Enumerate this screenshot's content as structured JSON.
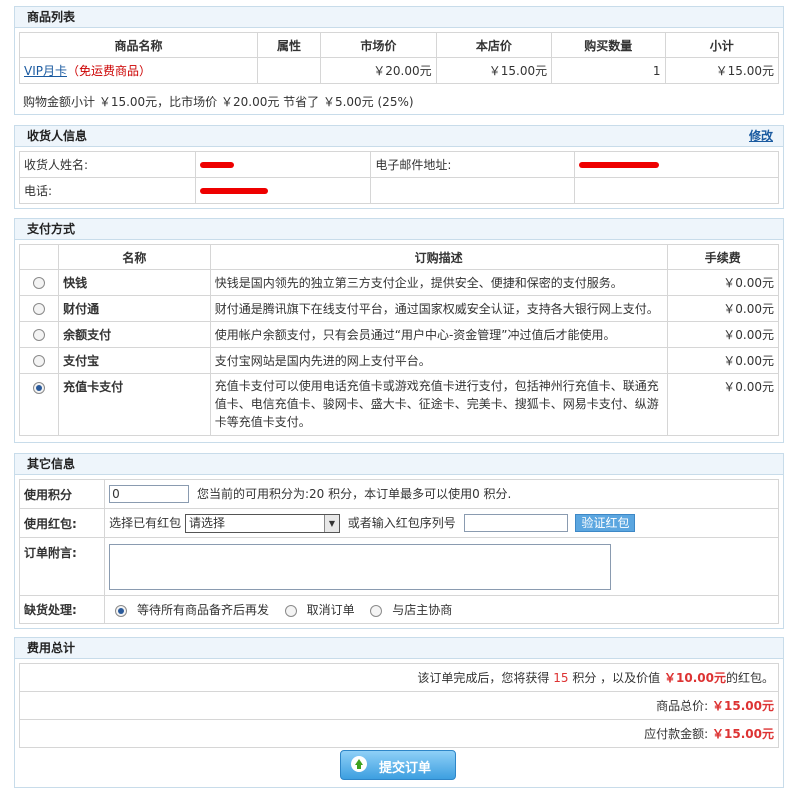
{
  "goods": {
    "title": "商品列表",
    "headers": [
      "商品名称",
      "属性",
      "市场价",
      "本店价",
      "购买数量",
      "小计"
    ],
    "item": {
      "name": "VIP月卡",
      "tag": "（免运费商品）",
      "attr": "",
      "market": "￥20.00元",
      "shop": "￥15.00元",
      "qty": "1",
      "subtotal": "￥15.00元"
    },
    "summary": "购物金额小计 ￥15.00元，比市场价 ￥20.00元 节省了 ￥5.00元 (25%)"
  },
  "consignee": {
    "title": "收货人信息",
    "edit": "修改",
    "name_label": "收货人姓名:",
    "email_label": "电子邮件地址:",
    "phone_label": "电话:"
  },
  "payment": {
    "title": "支付方式",
    "headers": [
      "名称",
      "订购描述",
      "手续费"
    ],
    "methods": [
      {
        "name": "快钱",
        "desc": "快钱是国内领先的独立第三方支付企业，提供安全、便捷和保密的支付服务。",
        "fee": "￥0.00元",
        "selected": false
      },
      {
        "name": "财付通",
        "desc": "财付通是腾讯旗下在线支付平台，通过国家权威安全认证，支持各大银行网上支付。",
        "fee": "￥0.00元",
        "selected": false
      },
      {
        "name": "余额支付",
        "desc": "使用帐户余额支付，只有会员通过“用户中心-资金管理”冲过值后才能使用。",
        "fee": "￥0.00元",
        "selected": false
      },
      {
        "name": "支付宝",
        "desc": "支付宝网站是国内先进的网上支付平台。",
        "fee": "￥0.00元",
        "selected": false
      },
      {
        "name": "充值卡支付",
        "desc_lines": [
          "充值卡支付可以使用电话充值卡或游戏充值卡进行支付，包括神州行充值卡、联通充",
          "值卡、电信充值卡、骏网卡、盛大卡、征途卡、完美卡、搜狐卡、网易卡支付、纵游",
          "卡等充值卡支付。"
        ],
        "fee": "￥0.00元",
        "selected": true
      }
    ]
  },
  "other": {
    "title": "其它信息",
    "points_label": "使用积分",
    "points_value": "0",
    "points_hint": "您当前的可用积分为:20 积分，本订单最多可以使用0 积分.",
    "bonus_label": "使用红包:",
    "bonus_select_label": "选择已有红包",
    "bonus_select_value": "请选择",
    "bonus_or": "或者输入红包序列号",
    "bonus_input": "",
    "bonus_button": "验证红包",
    "postscript_label": "订单附言:",
    "postscript_value": "",
    "shortage_label": "缺货处理:",
    "shortage_options": [
      {
        "label": "等待所有商品备齐后再发",
        "selected": true
      },
      {
        "label": "取消订单",
        "selected": false
      },
      {
        "label": "与店主协商",
        "selected": false
      }
    ]
  },
  "total": {
    "title": "费用总计",
    "bonus_pre": "该订单完成后，您将获得",
    "bonus_points": "15",
    "bonus_mid": "积分 ，以及价值",
    "bonus_value": "￥10.00元",
    "bonus_post": "的红包。",
    "goods_label": "商品总价:",
    "goods_amount": "￥15.00元",
    "pay_label": "应付款金额:",
    "pay_amount": "￥15.00元"
  },
  "submit_label": "提交订单"
}
